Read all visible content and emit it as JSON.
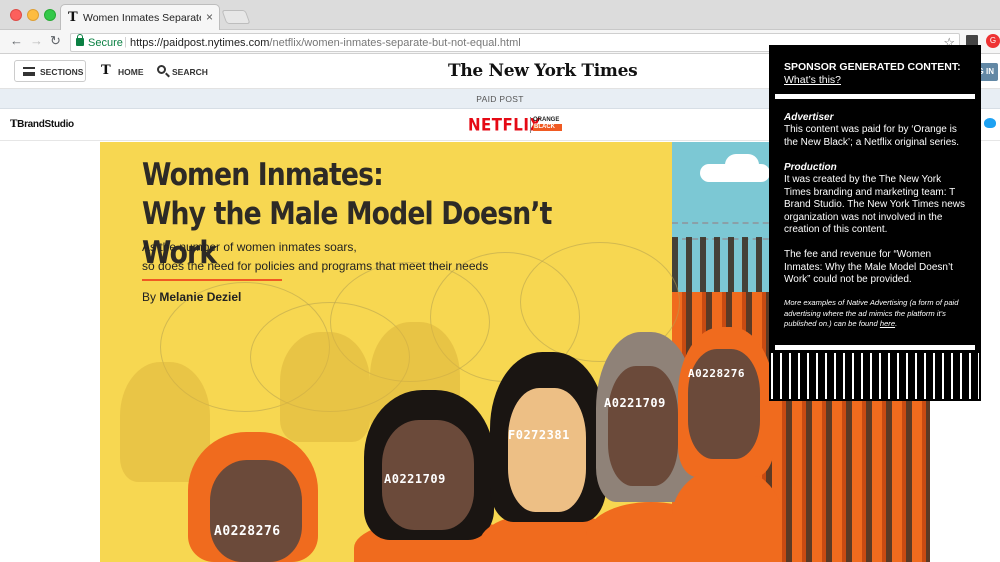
{
  "browser": {
    "tab_title": "Women Inmates Separate But",
    "tab_favicon": "T",
    "tab_close": "×",
    "nav": {
      "back": "←",
      "forward": "→",
      "reload": "↻"
    },
    "secure_label": "Secure",
    "url_host": "https://paidpost.nytimes.com",
    "url_path": "/netflix/women-inmates-separate-but-not-equal.html",
    "star": "☆",
    "extension_badge": "G"
  },
  "header": {
    "sections_label": "SECTIONS",
    "home_label": "HOME",
    "home_icon": "T",
    "search_label": "SEARCH",
    "logo": "The New York Times",
    "login_label": "G IN"
  },
  "paid_post": {
    "label": "PAID POST"
  },
  "brand_bar": {
    "tbrand_t": "T",
    "tbrand_text": "BrandStudio",
    "netflix": "NETFLIX",
    "oitnb_line1": "ORANGE",
    "oitnb_line2": "BLACK"
  },
  "hero": {
    "title_line1": "Women Inmates:",
    "title_line2": "Why the Male Model Doesn’t Work",
    "subtitle_line1": "As the number of women inmates soars,",
    "subtitle_line2": "so does the need for policies and programs that meet their needs",
    "byline_prefix": "By",
    "byline_name": "Melanie Deziel",
    "inmate_ids": [
      "A0228276",
      "A0221709",
      "F0272381",
      "A0221709",
      "A0228276"
    ]
  },
  "sponsor_panel": {
    "heading": "SPONSOR GENERATED CONTENT:",
    "whats_this": "What’s this?",
    "advertiser_label": "Advertiser",
    "advertiser_text": "This content was paid for by ‘Orange is the New Black’; a Netflix original series.",
    "production_label": "Production",
    "production_text": "It was created by the The New York Times branding and marketing team: T Brand Studio. The New York Times news organization was not involved in the creation of this content.",
    "fee_text": "The fee and revenue for “Women Inmates: Why the Male Model Doesn’t Work” could not be provided.",
    "more_text": "More examples of Native Advertising (a form of paid advertising where the ad mimics the platform it’s published on.) can be found",
    "more_link": "here"
  },
  "colors": {
    "hero_yellow": "#f7d751",
    "inmate_orange": "#f06b1e",
    "netflix_red": "#e50914",
    "sky_teal": "#7cc8d4"
  }
}
